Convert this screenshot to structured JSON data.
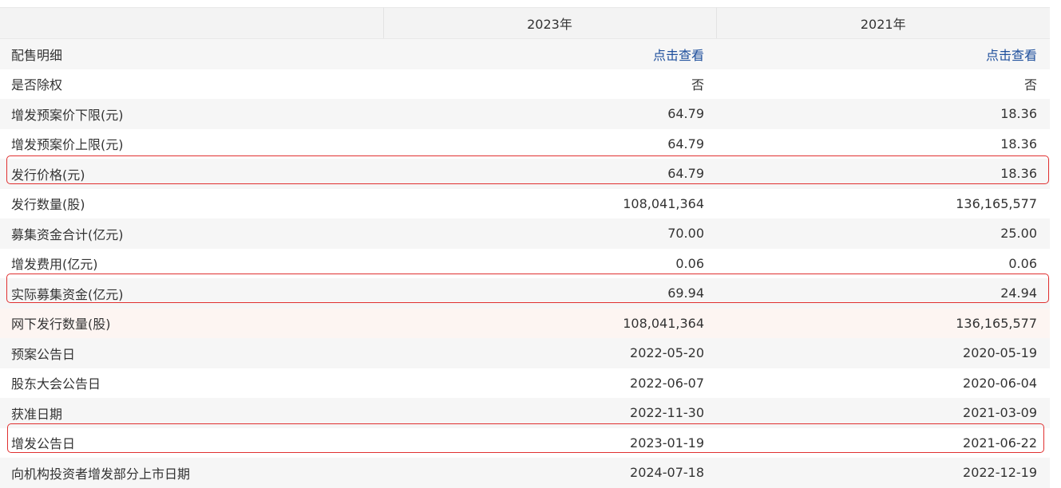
{
  "header": {
    "col0": "",
    "col1": "2023年",
    "col2": "2021年"
  },
  "rows": [
    {
      "label": "配售明细",
      "v1": "点击查看",
      "v2": "点击查看",
      "link": true
    },
    {
      "label": "是否除权",
      "v1": "否",
      "v2": "否"
    },
    {
      "label": "增发预案价下限(元)",
      "v1": "64.79",
      "v2": "18.36"
    },
    {
      "label": "增发预案价上限(元)",
      "v1": "64.79",
      "v2": "18.36"
    },
    {
      "label": "发行价格(元)",
      "v1": "64.79",
      "v2": "18.36"
    },
    {
      "label": "发行数量(股)",
      "v1": "108,041,364",
      "v2": "136,165,577"
    },
    {
      "label": "募集资金合计(亿元)",
      "v1": "70.00",
      "v2": "25.00"
    },
    {
      "label": "增发费用(亿元)",
      "v1": "0.06",
      "v2": "0.06"
    },
    {
      "label": "实际募集资金(亿元)",
      "v1": "69.94",
      "v2": "24.94"
    },
    {
      "label": "网下发行数量(股)",
      "v1": "108,041,364",
      "v2": "136,165,577"
    },
    {
      "label": "预案公告日",
      "v1": "2022-05-20",
      "v2": "2020-05-19"
    },
    {
      "label": "股东大会公告日",
      "v1": "2022-06-07",
      "v2": "2020-06-04"
    },
    {
      "label": "获准日期",
      "v1": "2022-11-30",
      "v2": "2021-03-09"
    },
    {
      "label": "增发公告日",
      "v1": "2023-01-19",
      "v2": "2021-06-22"
    },
    {
      "label": "向机构投资者增发部分上市日期",
      "v1": "2024-07-18",
      "v2": "2022-12-19"
    }
  ],
  "colors": {
    "link": "#1e4f9c",
    "highlight": "#e03030",
    "row_shade": "#f6f6f6",
    "row_hover": "#fdf5f2"
  }
}
